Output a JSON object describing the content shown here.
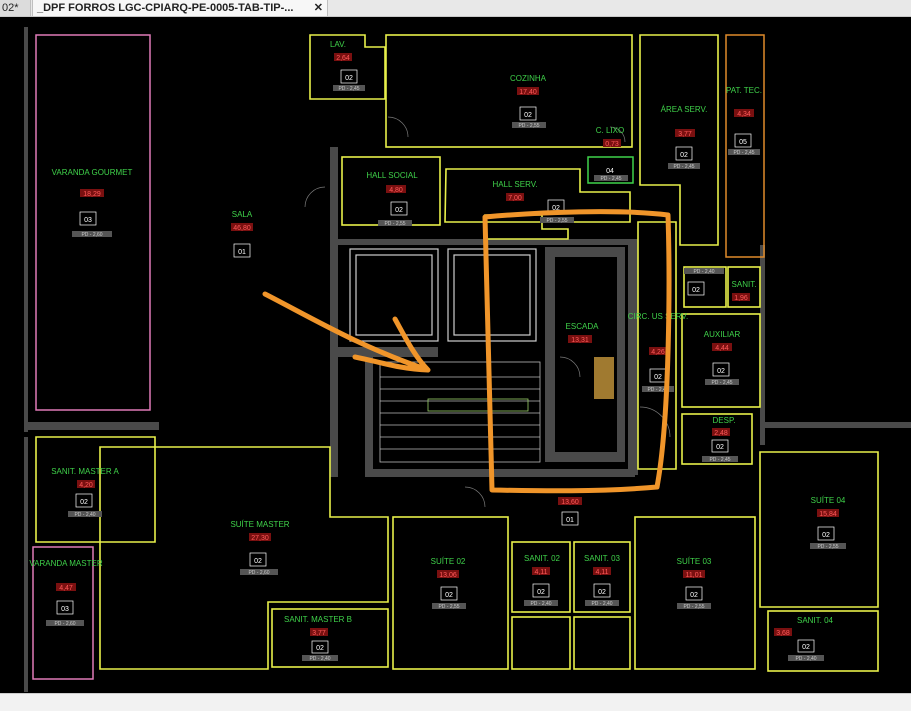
{
  "tabs": {
    "previous_label": "02*",
    "active_label": "_DPF FORROS LGC-CPIARQ-PE-0005-TAB-TIP-...",
    "close_symbol": "✕"
  },
  "icons": {
    "close": "close-icon"
  },
  "colors": {
    "room_outline": "#e8f04a",
    "room_label": "#3fd24a",
    "area_text": "#ff5a5a",
    "varanda_outline": "#e07ab8",
    "tecnico_outline": "#e08a2a",
    "lixo_outline": "#3fd24a",
    "annotation": "#f0952a"
  },
  "rooms": {
    "lav": {
      "name": "LAV.",
      "area": "2,64",
      "tag": "02",
      "ceiling": "PD - 2,45"
    },
    "cozinha": {
      "name": "COZINHA",
      "area": "17,40",
      "tag": "02",
      "ceiling": "PD - 2,55"
    },
    "area_serv": {
      "name": "ÁREA SERV.",
      "area": "3,77",
      "tag": "02",
      "ceiling": "PD - 2,45"
    },
    "pat_tec": {
      "name": "PAT. TEC.",
      "area": "4,34",
      "tag": "05",
      "ceiling": "PD - 2,45"
    },
    "c_lixo": {
      "name": "C. LIXO",
      "area": "0,73",
      "tag": "04",
      "ceiling": "PD - 2,45"
    },
    "hall_social": {
      "name": "HALL SOCIAL",
      "area": "4,80",
      "tag": "02",
      "ceiling": "PD - 2,55"
    },
    "hall_serv": {
      "name": "HALL SERV.",
      "area": "7,00",
      "tag": "02",
      "ceiling": "PD - 2,55"
    },
    "varanda_gourmet": {
      "name": "VARANDA GOURMET",
      "area": "18,29",
      "tag": "03",
      "ceiling": "PD - 2,60"
    },
    "sala": {
      "name": "SALA",
      "area": "46,80",
      "tag": "01"
    },
    "escada": {
      "name": "ESCADA",
      "area": "13,31"
    },
    "circ_serv": {
      "name": "CIRC. US SERV.",
      "area": "4,26",
      "tag": "02",
      "ceiling": "PD - 2,45"
    },
    "sanit_top": {
      "name": "SANIT.",
      "area": "1,96",
      "tag": "02",
      "ceiling": "PD - 2,40"
    },
    "auxiliar": {
      "name": "AUXILIAR",
      "area": "4,44",
      "tag": "02",
      "ceiling": "PD - 2,45"
    },
    "desp": {
      "name": "DESP.",
      "area": "2,48",
      "tag": "02",
      "ceiling": "PD - 2,45"
    },
    "sanit_master_a": {
      "name": "SANIT. MASTER A",
      "area": "4,20",
      "tag": "02",
      "ceiling": "PD - 2,40"
    },
    "suite_master": {
      "name": "SUÍTE MASTER",
      "area": "27,30",
      "tag": "02",
      "ceiling": "PD - 2,60"
    },
    "varanda_master": {
      "name": "VARANDA MASTER",
      "area": "4,47",
      "tag": "03",
      "ceiling": "PD - 2,60"
    },
    "sanit_master_b": {
      "name": "SANIT. MASTER B",
      "area": "3,77",
      "tag": "02",
      "ceiling": "PD - 2,40"
    },
    "corridor": {
      "area": "13,60",
      "tag": "01"
    },
    "suite_02": {
      "name": "SUÍTE 02",
      "area": "13,06",
      "tag": "02",
      "ceiling": "PD - 2,55"
    },
    "sanit_02": {
      "name": "SANIT. 02",
      "area": "4,11",
      "tag": "02",
      "ceiling": "PD - 2,40"
    },
    "sanit_03": {
      "name": "SANIT. 03",
      "area": "4,11",
      "tag": "02",
      "ceiling": "PD - 2,40"
    },
    "suite_03": {
      "name": "SUÍTE 03",
      "area": "11,01",
      "tag": "02",
      "ceiling": "PD - 2,55"
    },
    "suite_04": {
      "name": "SUÍTE 04",
      "area": "15,84",
      "tag": "02",
      "ceiling": "PD - 2,55"
    },
    "sanit_04": {
      "name": "SANIT. 04",
      "area": "3,68",
      "tag": "02",
      "ceiling": "PD - 2,40"
    }
  }
}
